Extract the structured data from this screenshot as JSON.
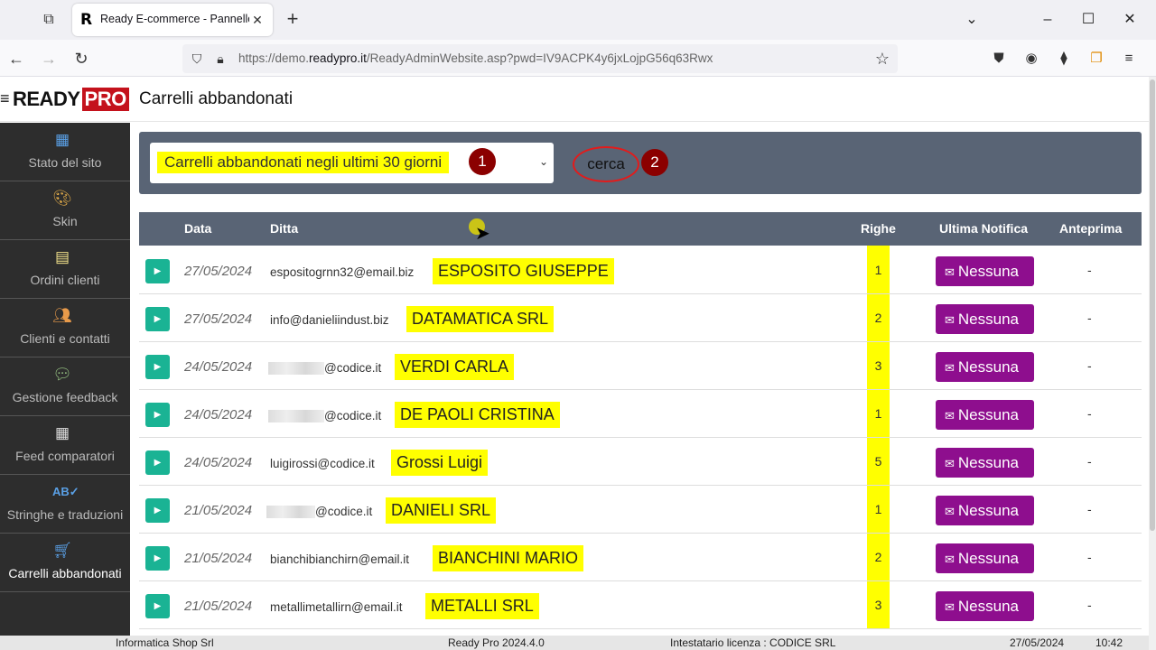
{
  "browser": {
    "tab_title": "Ready E-commerce - Pannello a",
    "url_prefix": "https://demo.",
    "url_domain": "readypro.it",
    "url_rest": "/ReadyAdminWebsite.asp?pwd=IV9ACPK4y6jxLojpG56q63Rwx"
  },
  "header": {
    "logo_ready": "READY",
    "logo_pro": "PRO",
    "title": "Carrelli abbandonati"
  },
  "sidebar": {
    "items": [
      {
        "label": "Stato del sito",
        "icon": "site-status-icon"
      },
      {
        "label": "Skin",
        "icon": "palette-icon"
      },
      {
        "label": "Ordini clienti",
        "icon": "orders-icon"
      },
      {
        "label": "Clienti e contatti",
        "icon": "contacts-icon"
      },
      {
        "label": "Gestione feedback",
        "icon": "feedback-icon"
      },
      {
        "label": "Feed comparatori",
        "icon": "grid-icon"
      },
      {
        "label": "Stringhe e traduzioni",
        "icon": "translate-icon"
      },
      {
        "label": "Carrelli abbandonati",
        "icon": "cart-icon"
      }
    ]
  },
  "filter": {
    "selected": "Carrelli abbandonati negli ultimi 30 giorni",
    "badge1": "1",
    "search_label": "cerca",
    "badge2": "2"
  },
  "table": {
    "headers": {
      "data": "Data",
      "ditta": "Ditta",
      "righe": "Righe",
      "notifica": "Ultima Notifica",
      "anteprima": "Anteprima"
    },
    "rows": [
      {
        "date": "27/05/2024",
        "email": "espositogrnn32@email.biz",
        "name": "ESPOSITO GIUSEPPE",
        "righe": "1",
        "notifica": "Nessuna",
        "anteprima": "-"
      },
      {
        "date": "27/05/2024",
        "email": "info@danieliindust.biz",
        "name": "DATAMATICA SRL",
        "righe": "2",
        "notifica": "Nessuna",
        "anteprima": "-"
      },
      {
        "date": "24/05/2024",
        "email": "@codice.it",
        "name": "VERDI CARLA",
        "righe": "3",
        "notifica": "Nessuna",
        "anteprima": "-"
      },
      {
        "date": "24/05/2024",
        "email": "@codice.it",
        "name": "DE PAOLI CRISTINA",
        "righe": "1",
        "notifica": "Nessuna",
        "anteprima": "-"
      },
      {
        "date": "24/05/2024",
        "email": "luigirossi@codice.it",
        "name": "Grossi Luigi",
        "righe": "5",
        "notifica": "Nessuna",
        "anteprima": "-"
      },
      {
        "date": "21/05/2024",
        "email": "@codice.it",
        "name": "DANIELI SRL",
        "righe": "1",
        "notifica": "Nessuna",
        "anteprima": "-"
      },
      {
        "date": "21/05/2024",
        "email": "bianchibianchirn@email.it",
        "name": "BIANCHINI MARIO",
        "righe": "2",
        "notifica": "Nessuna",
        "anteprima": "-"
      },
      {
        "date": "21/05/2024",
        "email": "metallimetallirn@email.it",
        "name": "METALLI SRL",
        "righe": "3",
        "notifica": "Nessuna",
        "anteprima": "-"
      }
    ]
  },
  "statusbar": {
    "seg1": "Informatica Shop Srl",
    "seg2": "Ready Pro 2024.4.0",
    "seg3": "Intestatario licenza : CODICE SRL",
    "seg4": "27/05/2024",
    "seg5": "10:42"
  },
  "colors": {
    "highlight": "#ffff00",
    "accent_green": "#1ab394",
    "notify_purple": "#8e0e8e",
    "panel": "#596475"
  }
}
